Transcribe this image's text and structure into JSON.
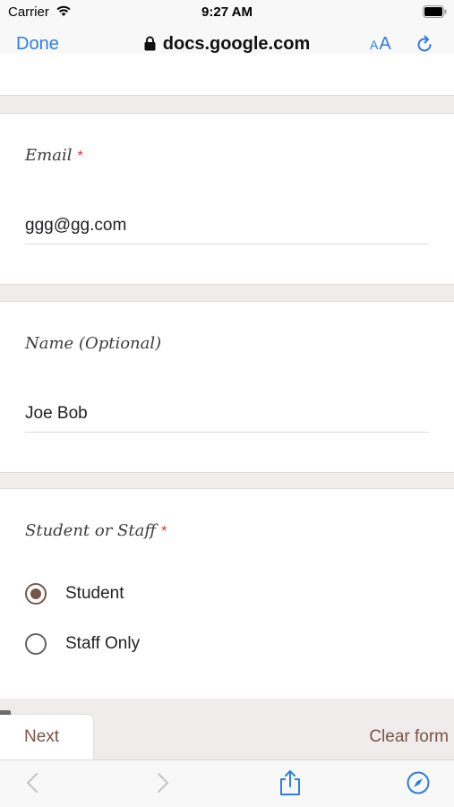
{
  "status_bar": {
    "carrier": "Carrier",
    "time": "9:27 AM"
  },
  "browser": {
    "done_label": "Done",
    "url": "docs.google.com",
    "text_size_label": "AA"
  },
  "questions": [
    {
      "title": "Email",
      "required": "*",
      "answer": "ggg@gg.com"
    },
    {
      "title": "Name (Optional)",
      "answer": "Joe Bob"
    },
    {
      "title": "Student or Staff",
      "required": "*",
      "options": [
        {
          "label": "Student",
          "selected": true
        },
        {
          "label": "Staff Only",
          "selected": false
        }
      ]
    }
  ],
  "form_actions": {
    "next_label": "Next",
    "clear_label": "Clear form"
  },
  "colors": {
    "accent": "#795548",
    "ios_blue": "#2f7de1",
    "required": "#d93025"
  },
  "toolbar": {
    "icons": [
      "back-icon",
      "forward-icon",
      "share-icon",
      "compass-icon"
    ]
  }
}
